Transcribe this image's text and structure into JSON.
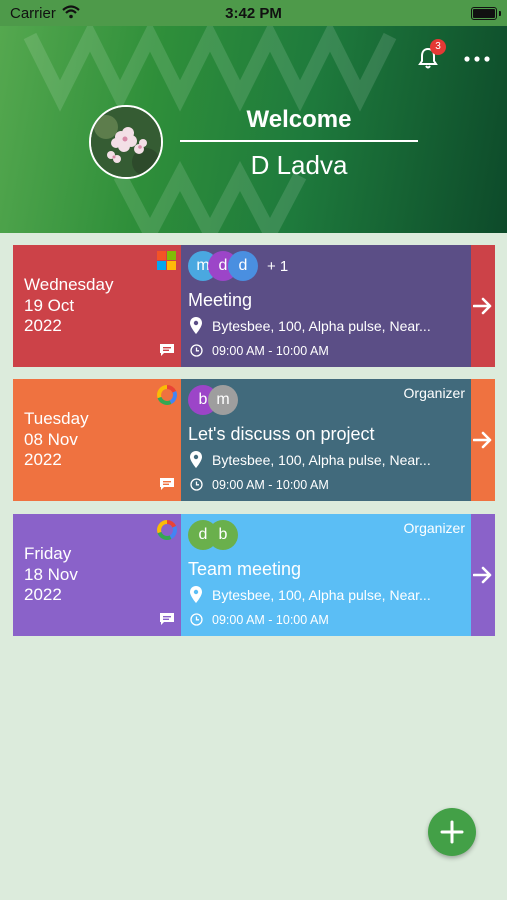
{
  "status_bar": {
    "carrier": "Carrier",
    "time": "3:42 PM"
  },
  "header": {
    "welcome_label": "Welcome",
    "username": "D Ladva",
    "notification_count": "3",
    "icons": [
      "bell-icon",
      "more-options-icon",
      "profile-avatar"
    ],
    "gradient_colors": [
      "#55a84f",
      "#0d4a2a"
    ]
  },
  "events": [
    {
      "day": "Wednesday",
      "date": "19 Oct",
      "year": "2022",
      "provider_icon": "microsoft-icon",
      "left_color": "#cc4248",
      "main_color": "#5b4e86",
      "arrow_color": "#cc4248",
      "attendees": [
        {
          "initial": "m",
          "color": "#4aa8e0"
        },
        {
          "initial": "d",
          "color": "#9c45c8"
        },
        {
          "initial": "d",
          "color": "#4a8fe0"
        }
      ],
      "extra_count": "+ 1",
      "organizer_label": "",
      "title": "Meeting",
      "location": "Bytesbee, 100, Alpha pulse, Near...",
      "time": "09:00 AM - 10:00 AM"
    },
    {
      "day": "Tuesday",
      "date": "08 Nov",
      "year": "2022",
      "provider_icon": "google-icon",
      "left_color": "#ef7240",
      "main_color": "#416a7c",
      "arrow_color": "#ef7240",
      "attendees": [
        {
          "initial": "b",
          "color": "#9c45c8"
        },
        {
          "initial": "m",
          "color": "#9e9e9e"
        }
      ],
      "extra_count": "",
      "organizer_label": "Organizer",
      "title": "Let's discuss on project",
      "location": "Bytesbee, 100, Alpha pulse, Near...",
      "time": "09:00 AM - 10:00 AM"
    },
    {
      "day": "Friday",
      "date": "18 Nov",
      "year": "2022",
      "provider_icon": "google-icon",
      "left_color": "#8a62c9",
      "main_color": "#5bbef5",
      "arrow_color": "#8a62c9",
      "attendees": [
        {
          "initial": "d",
          "color": "#6ab04c"
        },
        {
          "initial": "b",
          "color": "#6ab04c"
        }
      ],
      "extra_count": "",
      "organizer_label": "Organizer",
      "title": "Team meeting",
      "location": "Bytesbee, 100, Alpha pulse, Near...",
      "time": "09:00 AM - 10:00 AM"
    }
  ],
  "fab": {
    "icon": "plus-icon",
    "color": "#43a047"
  },
  "background_color": "#dcebdc"
}
